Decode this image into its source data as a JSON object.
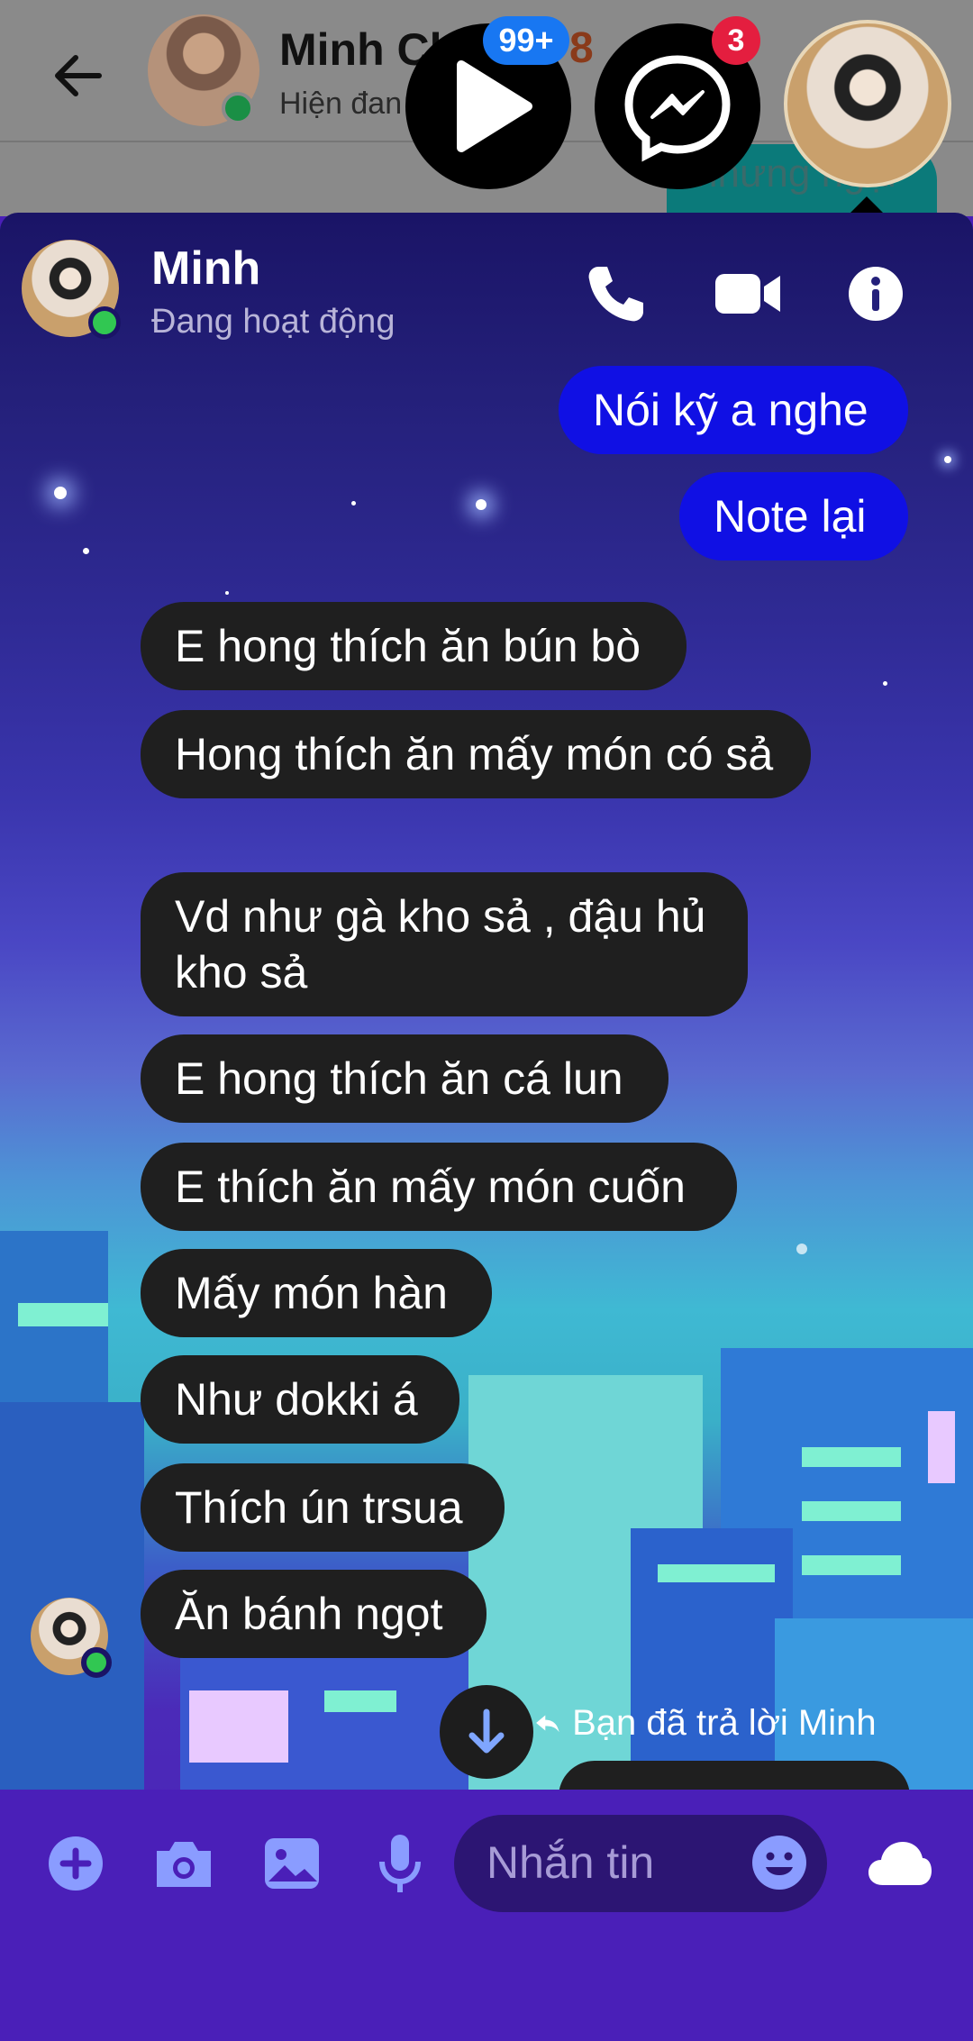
{
  "background_app": {
    "contact_name": "Minh Ch",
    "contact_status": "Hiện đan",
    "count_fragment": "8",
    "last_bubble_text": "nhưng ngại"
  },
  "chat_heads": {
    "play_badge": "99+",
    "messenger_badge": "3"
  },
  "conversation": {
    "contact_name": "Minh",
    "status": "Đang hoạt động",
    "actions": [
      "phone-icon",
      "video-icon",
      "info-icon"
    ]
  },
  "messages": [
    {
      "direction": "out",
      "text": "Nói kỹ a nghe"
    },
    {
      "direction": "out",
      "text": "Note lại"
    },
    {
      "direction": "in",
      "text": "E hong thích ăn bún bò"
    },
    {
      "direction": "in",
      "text": "Hong thích ăn mấy món có sả"
    },
    {
      "direction": "in",
      "text": "Vd như gà kho sả , đậu hủ kho sả"
    },
    {
      "direction": "in",
      "text": "E hong thích ăn cá lun"
    },
    {
      "direction": "in",
      "text": "E thích ăn mấy món cuốn"
    },
    {
      "direction": "in",
      "text": "Mấy món hàn"
    },
    {
      "direction": "in",
      "text": "Như dokki á"
    },
    {
      "direction": "in",
      "text": "Thích ún trsua"
    },
    {
      "direction": "in",
      "text": "Ăn bánh ngọt"
    }
  ],
  "reply_note": "Bạn đã trả lời Minh",
  "composer": {
    "placeholder": "Nhắn tin",
    "buttons": [
      "plus-icon",
      "camera-icon",
      "image-icon",
      "mic-icon",
      "emoji-icon",
      "cloud-icon"
    ]
  },
  "colors": {
    "outgoing_bubble": "#1010e4",
    "incoming_bubble": "#1f1f1f",
    "online": "#31c752",
    "theme": "#4a1fb8"
  }
}
